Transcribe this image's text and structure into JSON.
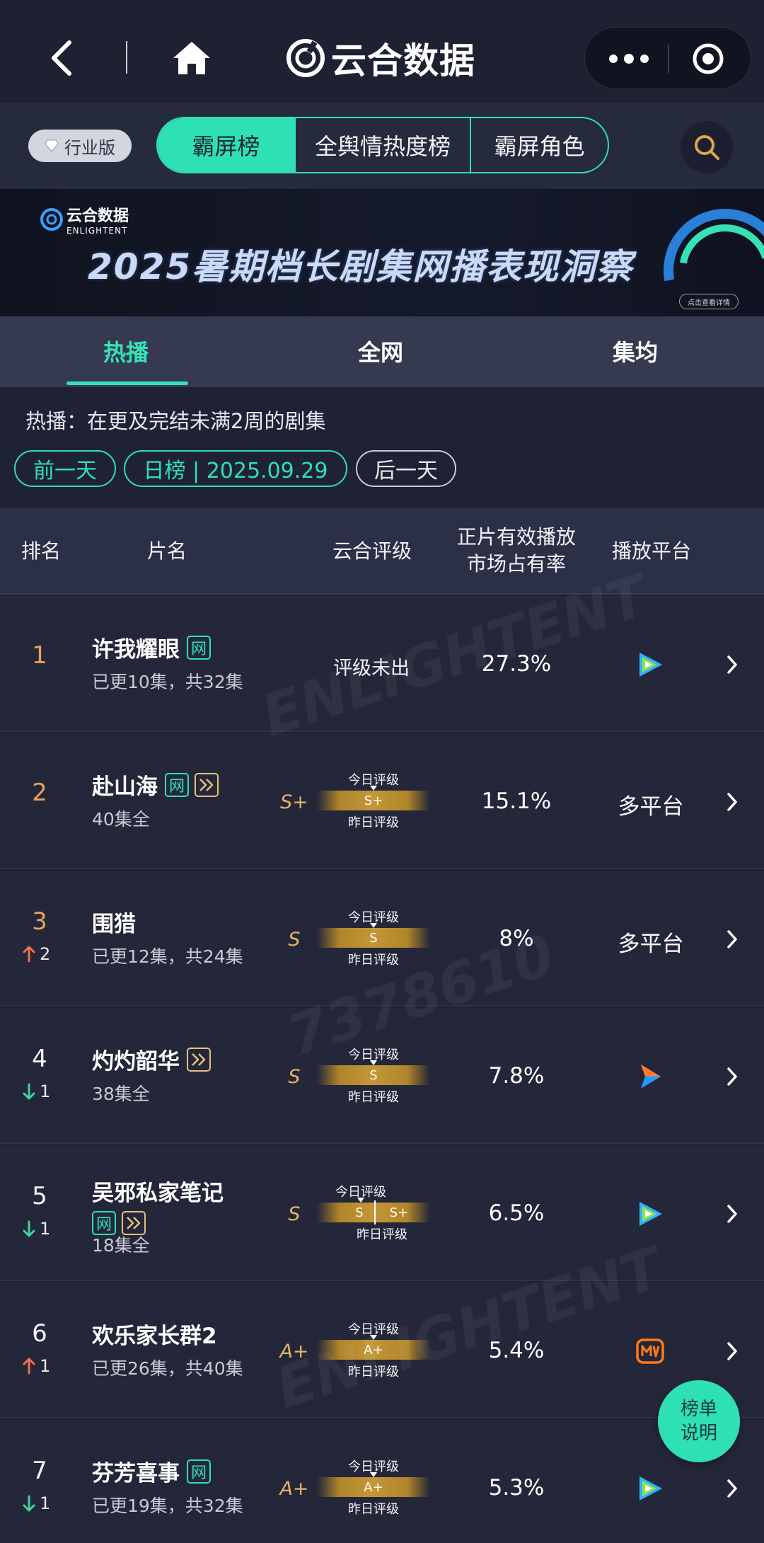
{
  "nav": {
    "app_name": "云合数据",
    "icons": {
      "back": "chevron-left-icon",
      "home": "home-icon",
      "more": "more-dots-icon",
      "target": "target-icon"
    }
  },
  "tabs": {
    "edition_badge": "行业版",
    "pills": [
      {
        "label": "霸屏榜",
        "active": true
      },
      {
        "label": "全舆情热度榜",
        "active": false
      },
      {
        "label": "霸屏角色",
        "active": false
      }
    ]
  },
  "banner": {
    "logo_cn": "云合数据",
    "logo_en": "ENLIGHTENT",
    "title": "2025暑期档长剧集网播表现洞察",
    "detail_button": "点击查看详情"
  },
  "subtabs": [
    {
      "label": "热播",
      "active": true
    },
    {
      "label": "全网",
      "active": false
    },
    {
      "label": "集均",
      "active": false
    }
  ],
  "description": "热播：在更及完结未满2周的剧集",
  "date_nav": {
    "prev": "前一天",
    "current": "日榜 | 2025.09.29",
    "next": "后一天"
  },
  "table": {
    "headers": {
      "rank": "排名",
      "title": "片名",
      "grade": "云合评级",
      "share_line1": "正片有效播放",
      "share_line2": "市场占有率",
      "platform": "播放平台"
    },
    "gauge_labels": {
      "today": "今日评级",
      "yesterday": "昨日评级"
    },
    "rows": [
      {
        "rank": "1",
        "title": "许我耀眼",
        "tags": [
          "网"
        ],
        "episodes": "已更10集，共32集",
        "trend": "",
        "trend_dir": "",
        "grade": "",
        "grade_text": "评级未出",
        "gauge_today": "",
        "gauge_yesterday": "",
        "share": "27.3%",
        "platform_text": "",
        "platform_icon": "tencent-video-icon"
      },
      {
        "rank": "2",
        "title": "赴山海",
        "tags": [
          "网",
          "play"
        ],
        "episodes": "40集全",
        "trend": "",
        "trend_dir": "",
        "grade": "S+",
        "grade_text": "",
        "gauge_today": "S+",
        "gauge_yesterday": "",
        "share": "15.1%",
        "platform_text": "多平台",
        "platform_icon": ""
      },
      {
        "rank": "3",
        "title": "围猎",
        "tags": [],
        "episodes": "已更12集，共24集",
        "trend": "2",
        "trend_dir": "up",
        "grade": "S",
        "grade_text": "",
        "gauge_today": "S",
        "gauge_yesterday": "",
        "share": "8%",
        "platform_text": "多平台",
        "platform_icon": ""
      },
      {
        "rank": "4",
        "title": "灼灼韶华",
        "tags": [
          "play"
        ],
        "episodes": "38集全",
        "trend": "1",
        "trend_dir": "down",
        "grade": "S",
        "grade_text": "",
        "gauge_today": "S",
        "gauge_yesterday": "",
        "share": "7.8%",
        "platform_text": "",
        "platform_icon": "youku-icon"
      },
      {
        "rank": "5",
        "title": "吴邪私家笔记",
        "tags": [
          "网",
          "play"
        ],
        "episodes": "18集全",
        "trend": "1",
        "trend_dir": "down",
        "grade": "S",
        "grade_text": "",
        "gauge_today": "S",
        "gauge_yesterday": "S+",
        "share": "6.5%",
        "platform_text": "",
        "platform_icon": "tencent-video-icon"
      },
      {
        "rank": "6",
        "title": "欢乐家长群2",
        "tags": [],
        "episodes": "已更26集，共40集",
        "trend": "1",
        "trend_dir": "up",
        "grade": "A+",
        "grade_text": "",
        "gauge_today": "A+",
        "gauge_yesterday": "",
        "share": "5.4%",
        "platform_text": "",
        "platform_icon": "mango-tv-icon"
      },
      {
        "rank": "7",
        "title": "芬芳喜事",
        "tags": [
          "网"
        ],
        "episodes": "已更19集，共32集",
        "trend": "1",
        "trend_dir": "down",
        "grade": "A+",
        "grade_text": "",
        "gauge_today": "A+",
        "gauge_yesterday": "",
        "share": "5.3%",
        "platform_text": "",
        "platform_icon": "tencent-video-icon"
      }
    ]
  },
  "help_button": {
    "line1": "榜单",
    "line2": "说明"
  },
  "colors": {
    "accent": "#2fe0b4",
    "rank_top3": "#e8a05c",
    "grade": "#e2b563",
    "trend_up": "#f0704f",
    "trend_down": "#3fd49d"
  }
}
